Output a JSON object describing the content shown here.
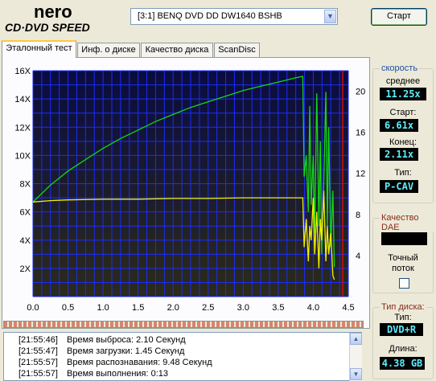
{
  "app": {
    "logo_top": "nero",
    "logo_bottom": "CD·DVD SPEED"
  },
  "toolbar": {
    "drive": "[3:1]  BENQ DVD DD DW1640 BSHB",
    "start_label": "Старт"
  },
  "tabs": [
    {
      "label": "Эталонный тест",
      "active": true
    },
    {
      "label": "Инф. о диске",
      "active": false
    },
    {
      "label": "Качество диска",
      "active": false
    },
    {
      "label": "ScanDisc",
      "active": false
    }
  ],
  "speed": {
    "title": "скорость",
    "average_label": "среднее",
    "average_value": "11.25x",
    "start_label": "Старт:",
    "start_value": "6.61x",
    "end_label": "Конец:",
    "end_value": "2.11x",
    "type_label": "Тип:",
    "type_value": "P-CAV"
  },
  "dae": {
    "title": "Качество DAE",
    "accurate_label_1": "Точный",
    "accurate_label_2": "поток",
    "accurate_checked": false
  },
  "disc": {
    "title": "Тип диска:",
    "type_label": "Тип:",
    "type_value": "DVD+R",
    "length_label": "Длина:",
    "length_value": "4.38 GB"
  },
  "log": [
    {
      "time": "[21:55:46]",
      "text": "Время выброса: 2.10 Секунд"
    },
    {
      "time": "[21:55:47]",
      "text": "Время загрузки: 1.45 Секунд"
    },
    {
      "time": "[21:55:57]",
      "text": "Время распознавания: 9.48 Секунд"
    },
    {
      "time": "[21:55:57]",
      "text": "Время выполнения: 0:13"
    }
  ],
  "colors": {
    "plot_bg_top": "#0a0c40",
    "plot_bg_bottom": "#2c2a1a",
    "grid": "#1a2cff",
    "speed_line": "#16d616",
    "rpm_line": "#f2f200",
    "end_marker": "#d01010",
    "value_text": "#5cf0ff"
  },
  "chart_data": {
    "type": "line",
    "x_ticks": [
      "0.0",
      "0.5",
      "1.0",
      "1.5",
      "2.0",
      "2.5",
      "3.0",
      "3.5",
      "4.0",
      "4.5"
    ],
    "y_left_ticks": [
      "2X",
      "4X",
      "6X",
      "8X",
      "10X",
      "12X",
      "14X",
      "16X"
    ],
    "y_right_ticks": [
      "4",
      "8",
      "12",
      "16",
      "20"
    ],
    "xlim": [
      0,
      4.5
    ],
    "ylim": [
      0,
      16
    ],
    "y2lim": [
      0,
      22
    ],
    "grid": true,
    "series": [
      {
        "x": [
          0.0,
          0.25,
          0.5,
          0.75,
          1.0,
          1.25,
          1.5,
          1.75,
          2.0,
          2.25,
          2.5,
          2.75,
          3.0,
          3.25,
          3.5,
          3.75,
          3.85,
          3.87,
          3.9,
          3.93,
          3.95,
          3.97,
          4.0,
          4.02,
          4.05,
          4.08,
          4.1,
          4.12,
          4.15,
          4.18,
          4.2,
          4.22,
          4.25,
          4.28,
          4.3
        ],
        "y": [
          6.7,
          7.9,
          8.9,
          9.7,
          10.5,
          11.2,
          11.8,
          12.4,
          12.9,
          13.4,
          13.8,
          14.2,
          14.6,
          14.9,
          15.2,
          15.5,
          15.6,
          8.5,
          10.0,
          6.0,
          13.5,
          6.5,
          10.0,
          4.5,
          14.4,
          5.0,
          11.0,
          3.0,
          8.0,
          14.5,
          5.0,
          12.0,
          3.5,
          7.5,
          2.1
        ]
      },
      {
        "x": [
          0.0,
          0.25,
          0.5,
          1.0,
          1.5,
          2.0,
          2.5,
          3.0,
          3.5,
          3.85,
          3.87,
          3.9,
          3.93,
          3.95,
          3.97,
          4.0,
          4.02,
          4.05,
          4.08,
          4.1,
          4.12,
          4.15,
          4.18,
          4.2,
          4.22,
          4.25,
          4.28,
          4.3
        ],
        "y": [
          6.7,
          6.8,
          6.85,
          6.9,
          6.9,
          6.95,
          6.95,
          7.0,
          7.0,
          7.0,
          3.5,
          5.5,
          2.5,
          5.0,
          4.0,
          7.0,
          3.0,
          6.0,
          2.0,
          5.5,
          4.0,
          7.5,
          2.5,
          5.0,
          3.0,
          4.5,
          1.5,
          1.2
        ]
      }
    ]
  }
}
